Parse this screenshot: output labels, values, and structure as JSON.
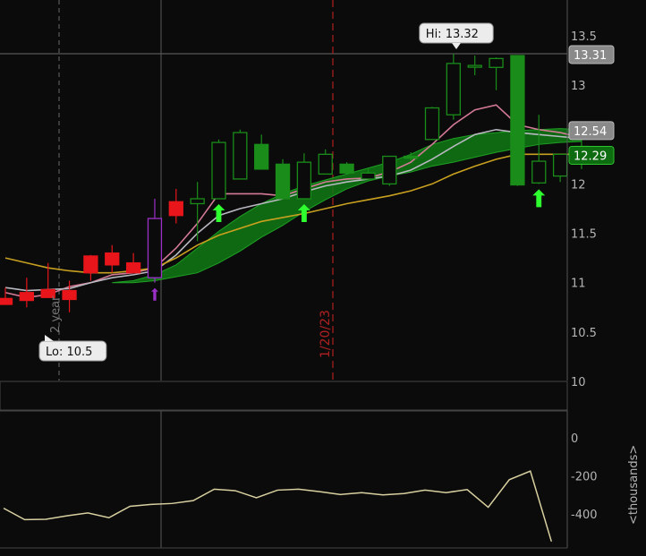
{
  "colors": {
    "background": "#0b0b0b",
    "grid": "#3a3a3a",
    "axis_text": "#b4b4b4",
    "up_candle": "#1a8c1a",
    "down_candle": "#e8151a",
    "hollow_purple": "#9b30c8",
    "cloud_fill": "#0f7a14",
    "line_pink": "#d47a96",
    "line_gray": "#b8b8c0",
    "line_gold": "#c8a020",
    "signal_arrow": "#2eff2e",
    "volume_line": "#d8d0a0",
    "date_marker": "#b02020"
  },
  "chart_data": [
    {
      "type": "candlestick",
      "title": "",
      "y_axis": {
        "ticks": [
          "13.5",
          "13",
          "12.5",
          "12",
          "11.5",
          "11",
          "10.5",
          "10"
        ],
        "range": [
          10.0,
          13.7
        ],
        "position": "right"
      },
      "price_tags": [
        {
          "label": "13.31",
          "value": 13.31,
          "style": "gray"
        },
        {
          "label": "12.54",
          "value": 12.54,
          "style": "gray"
        },
        {
          "label": "12.29",
          "value": 12.29,
          "style": "green"
        }
      ],
      "annotations": {
        "hi_label": "Hi: 13.32",
        "lo_label": "Lo: 10.5",
        "date_marker": "1/20/23",
        "period_label": "2 year"
      },
      "candles": [
        {
          "o": 10.84,
          "h": 10.95,
          "l": 10.78,
          "c": 10.78,
          "dir": "down"
        },
        {
          "o": 10.9,
          "h": 11.05,
          "l": 10.75,
          "c": 10.82,
          "dir": "down"
        },
        {
          "o": 10.93,
          "h": 11.2,
          "l": 10.85,
          "c": 10.85,
          "dir": "down"
        },
        {
          "o": 10.92,
          "h": 11.02,
          "l": 10.7,
          "c": 10.83,
          "dir": "down"
        },
        {
          "o": 11.1,
          "h": 11.28,
          "l": 11.02,
          "c": 11.27,
          "dir": "down"
        },
        {
          "o": 11.3,
          "h": 11.38,
          "l": 11.1,
          "c": 11.18,
          "dir": "down"
        },
        {
          "o": 11.2,
          "h": 11.3,
          "l": 11.1,
          "c": 11.1,
          "dir": "down"
        },
        {
          "o": 11.05,
          "h": 11.85,
          "l": 11.0,
          "c": 11.65,
          "dir": "purple"
        },
        {
          "o": 11.82,
          "h": 11.95,
          "l": 11.6,
          "c": 11.68,
          "dir": "down"
        },
        {
          "o": 11.85,
          "h": 12.02,
          "l": 11.42,
          "c": 11.8,
          "dir": "up"
        },
        {
          "o": 11.85,
          "h": 12.45,
          "l": 11.85,
          "c": 12.42,
          "dir": "up"
        },
        {
          "o": 12.05,
          "h": 12.55,
          "l": 12.05,
          "c": 12.52,
          "dir": "up"
        },
        {
          "o": 12.4,
          "h": 12.5,
          "l": 12.15,
          "c": 12.15,
          "dir": "up_solid"
        },
        {
          "o": 12.2,
          "h": 12.25,
          "l": 11.85,
          "c": 11.85,
          "dir": "up_solid"
        },
        {
          "o": 11.85,
          "h": 12.31,
          "l": 11.85,
          "c": 12.22,
          "dir": "up"
        },
        {
          "o": 12.1,
          "h": 12.35,
          "l": 12.1,
          "c": 12.3,
          "dir": "up"
        },
        {
          "o": 12.2,
          "h": 12.22,
          "l": 12.1,
          "c": 12.11,
          "dir": "up_solid"
        },
        {
          "o": 12.05,
          "h": 12.15,
          "l": 12.05,
          "c": 12.11,
          "dir": "up"
        },
        {
          "o": 12.0,
          "h": 12.28,
          "l": 11.98,
          "c": 12.28,
          "dir": "up"
        },
        {
          "o": 12.28,
          "h": 12.32,
          "l": 12.24,
          "c": 12.26,
          "dir": "up_solid"
        },
        {
          "o": 12.45,
          "h": 12.78,
          "l": 12.45,
          "c": 12.77,
          "dir": "up"
        },
        {
          "o": 12.7,
          "h": 13.32,
          "l": 12.65,
          "c": 13.22,
          "dir": "up"
        },
        {
          "o": 13.2,
          "h": 13.3,
          "l": 13.1,
          "c": 13.2,
          "dir": "up"
        },
        {
          "o": 13.18,
          "h": 13.28,
          "l": 12.95,
          "c": 13.27,
          "dir": "up"
        },
        {
          "o": 13.3,
          "h": 13.3,
          "l": 11.98,
          "c": 11.99,
          "dir": "up_solid"
        },
        {
          "o": 12.01,
          "h": 12.7,
          "l": 12.0,
          "c": 12.23,
          "dir": "up"
        },
        {
          "o": 12.08,
          "h": 12.3,
          "l": 12.02,
          "c": 12.3,
          "dir": "up"
        },
        {
          "o": 12.38,
          "h": 12.58,
          "l": 12.15,
          "c": 12.29,
          "dir": "up_solid"
        }
      ],
      "series": [
        {
          "style": "pink",
          "values": [
            10.9,
            10.85,
            10.88,
            10.96,
            11.0,
            11.08,
            11.1,
            11.15,
            11.35,
            11.6,
            11.9,
            11.9,
            11.9,
            11.88,
            11.95,
            12.02,
            12.05,
            12.06,
            12.12,
            12.22,
            12.4,
            12.6,
            12.75,
            12.8,
            12.6,
            12.55,
            12.52,
            12.47
          ]
        },
        {
          "style": "gray",
          "values": [
            10.95,
            10.92,
            10.93,
            10.94,
            11.0,
            11.05,
            11.08,
            11.12,
            11.28,
            11.5,
            11.68,
            11.75,
            11.8,
            11.85,
            11.92,
            11.98,
            12.02,
            12.05,
            12.08,
            12.14,
            12.25,
            12.38,
            12.5,
            12.55,
            12.52,
            12.5,
            12.48,
            12.46
          ]
        },
        {
          "style": "gold",
          "values": [
            11.25,
            11.2,
            11.15,
            11.12,
            11.1,
            11.1,
            11.12,
            11.15,
            11.25,
            11.38,
            11.48,
            11.55,
            11.62,
            11.66,
            11.7,
            11.75,
            11.8,
            11.84,
            11.88,
            11.93,
            12.0,
            12.1,
            12.18,
            12.25,
            12.3,
            12.3,
            12.3,
            12.3
          ]
        }
      ],
      "cloud": {
        "start_index": 5,
        "upper": [
          11.0,
          11.02,
          11.08,
          11.18,
          11.35,
          11.52,
          11.67,
          11.8,
          11.9,
          11.98,
          12.04,
          12.1,
          12.16,
          12.22,
          12.3,
          12.4,
          12.46,
          12.5,
          12.52,
          12.54,
          12.55,
          12.56,
          12.55
        ],
        "lower": [
          11.0,
          11.0,
          11.02,
          11.06,
          11.1,
          11.2,
          11.32,
          11.46,
          11.58,
          11.72,
          11.84,
          11.95,
          12.03,
          12.08,
          12.12,
          12.18,
          12.22,
          12.27,
          12.32,
          12.36,
          12.4,
          12.42,
          12.43
        ]
      },
      "signal_arrows": [
        {
          "index": 7,
          "color": "purple"
        },
        {
          "index": 10,
          "color": "green"
        },
        {
          "index": 14,
          "color": "green"
        },
        {
          "index": 25,
          "color": "green"
        }
      ]
    },
    {
      "type": "line",
      "title": "",
      "ylabel": "<thousands>",
      "y_axis": {
        "ticks": [
          "0",
          "-200",
          "-400"
        ],
        "range": [
          -560,
          100
        ]
      },
      "series": [
        {
          "name": "",
          "values": [
            -370,
            -430,
            -428,
            -410,
            -395,
            -420,
            -360,
            -350,
            -345,
            -330,
            -270,
            -278,
            -315,
            -275,
            -270,
            -283,
            -298,
            -288,
            -300,
            -293,
            -275,
            -288,
            -272,
            -365,
            -220,
            -175,
            -545
          ]
        }
      ]
    }
  ]
}
